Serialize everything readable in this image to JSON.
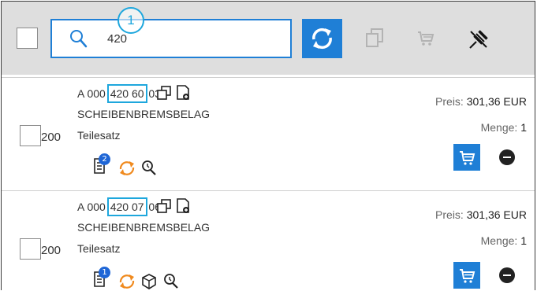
{
  "search": {
    "value": "420",
    "callout": "1"
  },
  "items": [
    {
      "part_prefix": "A 000 ",
      "part_highlight": "420 60",
      "part_suffix": " 03",
      "description": "SCHEIBENBREMSBELAG",
      "position": "200",
      "type": "Teilesatz",
      "price_label": "Preis:",
      "price_value": "301,36 EUR",
      "qty_label": "Menge:",
      "qty_value": "1",
      "badge": "2"
    },
    {
      "part_prefix": "A 000 ",
      "part_highlight": "420 07",
      "part_suffix": " 06",
      "description": "SCHEIBENBREMSBELAG",
      "position": "200",
      "type": "Teilesatz",
      "price_label": "Preis:",
      "price_value": "301,36 EUR",
      "qty_label": "Menge:",
      "qty_value": "1",
      "badge": "1"
    }
  ],
  "colors": {
    "accent": "#1f7fd6",
    "callout": "#1ea7dd",
    "orange": "#f08a1e"
  }
}
